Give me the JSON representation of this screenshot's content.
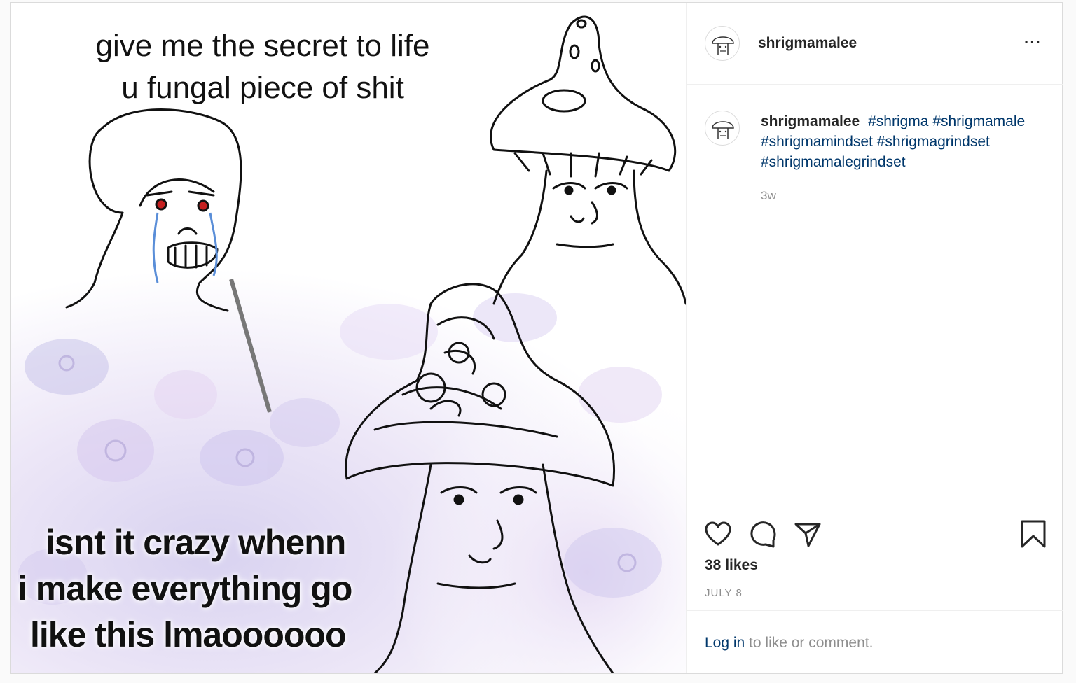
{
  "meme": {
    "top_line1": "give me the secret to life",
    "top_line2": "u fungal piece of shit",
    "bottom_line1": "isnt it crazy whenn",
    "bottom_line2": "i make everything go",
    "bottom_line3": "like this lmaoooooo"
  },
  "header": {
    "username": "shrigmamalee",
    "more_icon": "more-options-icon",
    "more_label": "···"
  },
  "caption": {
    "username": "shrigmamalee",
    "hashtags": [
      "#shrigma",
      "#shrigmamale",
      "#shrigmamindset",
      "#shrigmagrindset",
      "#shrigmamalegrindset"
    ],
    "ago": "3w"
  },
  "actions": {
    "icons": [
      "heart-icon",
      "comment-icon",
      "share-icon",
      "bookmark-icon"
    ]
  },
  "likes": "38 likes",
  "date": "JULY 8",
  "login": {
    "link": "Log in",
    "rest": " to like or comment."
  },
  "colors": {
    "link": "#00376b",
    "muted": "#8e8e8e",
    "text": "#262626",
    "border": "#dbdbdb"
  }
}
